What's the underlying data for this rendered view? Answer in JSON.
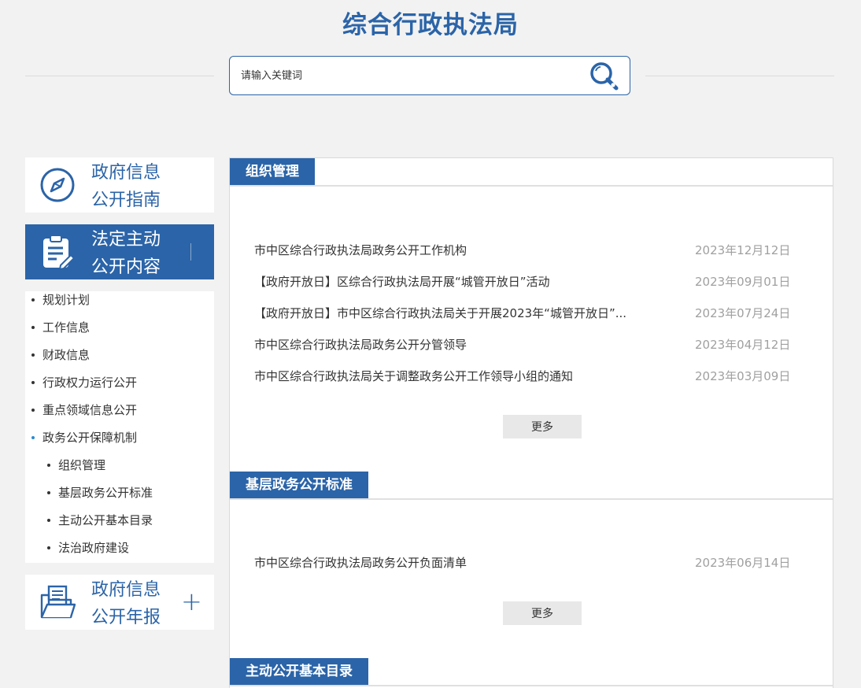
{
  "header": {
    "title": "综合行政执法局",
    "search_placeholder": "请输入关键词"
  },
  "sidebar": {
    "guide": "政府信息公开指南",
    "guide_line1": "政府信息",
    "guide_line2": "公开指南",
    "statutory_line1": "法定主动",
    "statutory_line2": "公开内容",
    "items": [
      {
        "label": "规划计划"
      },
      {
        "label": "工作信息"
      },
      {
        "label": "财政信息"
      },
      {
        "label": "行政权力运行公开"
      },
      {
        "label": "重点领域信息公开"
      },
      {
        "label": "政务公开保障机制"
      }
    ],
    "subitems": [
      {
        "label": "组织管理"
      },
      {
        "label": "基层政务公开标准"
      },
      {
        "label": "主动公开基本目录"
      },
      {
        "label": "法治政府建设"
      }
    ],
    "annual_line1": "政府信息",
    "annual_line2": "公开年报",
    "annual_expand": "+"
  },
  "sections": [
    {
      "title": "组织管理",
      "more": "更多",
      "rows": [
        {
          "title": "市中区综合行政执法局政务公开工作机构",
          "date": "2023年12月12日"
        },
        {
          "title": "【政府开放日】区综合行政执法局开展“城管开放日”活动",
          "date": "2023年09月01日"
        },
        {
          "title": "【政府开放日】市中区综合行政执法局关于开展2023年“城管开放日”...",
          "date": "2023年07月24日"
        },
        {
          "title": "市中区综合行政执法局政务公开分管领导",
          "date": "2023年04月12日"
        },
        {
          "title": "市中区综合行政执法局关于调整政务公开工作领导小组的通知",
          "date": "2023年03月09日"
        }
      ]
    },
    {
      "title": "基层政务公开标准",
      "more": "更多",
      "rows": [
        {
          "title": "市中区综合行政执法局政务公开负面清单",
          "date": "2023年06月14日"
        }
      ]
    },
    {
      "title": "主动公开基本目录"
    }
  ],
  "colors": {
    "brand": "#2b64a8",
    "date": "#a0a0a0",
    "background": "#f2f2f2"
  }
}
